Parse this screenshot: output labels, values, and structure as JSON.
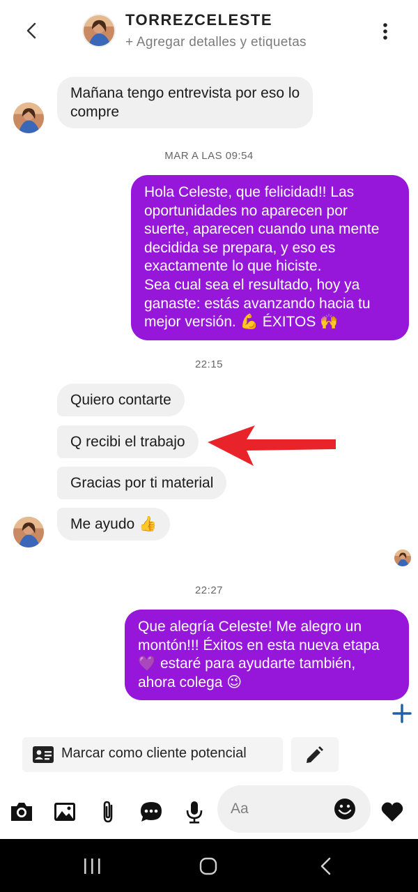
{
  "header": {
    "contact_name": "TORREZCELESTE",
    "subtitle": "+ Agregar detalles y etiquetas"
  },
  "messages": [
    {
      "from": "contact",
      "text_lines": [
        "Mañana tengo entrevista por eso lo",
        "compre"
      ]
    },
    {
      "timestamp": "MAR A LAS 09:54"
    },
    {
      "from": "me",
      "text_lines": [
        "Hola Celeste, que felicidad!! Las",
        "oportunidades no aparecen por",
        "suerte, aparecen cuando una mente",
        "decidida se prepara, y eso es",
        "exactamente lo que hiciste.",
        "Sea cual sea el resultado, hoy ya",
        "ganaste: estás avanzando hacia tu",
        "mejor versión. 💪 ÉXITOS 🙌"
      ]
    },
    {
      "timestamp": "22:15"
    },
    {
      "from": "contact",
      "text": "Quiero contarte"
    },
    {
      "from": "contact",
      "text": "Q recibi el trabajo"
    },
    {
      "from": "contact",
      "text": "Gracias por ti material"
    },
    {
      "from": "contact",
      "text": "Me ayudo 👍"
    },
    {
      "timestamp": "22:27"
    },
    {
      "from": "me",
      "text_lines": [
        "Que alegría Celeste! Me alegro un",
        "montón!!! Éxitos en esta nueva etapa",
        "💜 estaré para ayudarte también,",
        "ahora colega 😉"
      ]
    }
  ],
  "actions": {
    "mark_lead_label": "Marcar como cliente potencial"
  },
  "composer": {
    "placeholder": "Aa"
  },
  "icons": {
    "back": "chevron-left-icon",
    "more": "more-vertical-icon",
    "plus": "plus-icon",
    "lead": "contact-card-icon",
    "edit": "pencil-icon",
    "camera": "camera-icon",
    "gallery": "image-icon",
    "attach": "paperclip-icon",
    "chat": "chat-bubble-icon",
    "mic": "microphone-icon",
    "emoji": "emoji-icon",
    "like": "heart-icon"
  },
  "colors": {
    "outgoing_bubble": "#9616d9",
    "incoming_bubble": "#f0f0f0",
    "annotation_arrow": "#e8242a",
    "plus_accent": "#1e5fa8"
  }
}
